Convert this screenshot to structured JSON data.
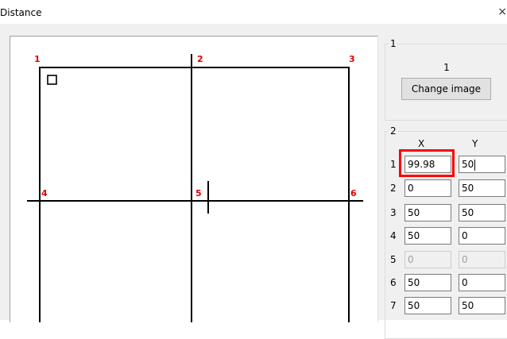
{
  "window": {
    "title": "Distance",
    "close_icon": "×"
  },
  "canvas": {
    "points": [
      {
        "label": "1"
      },
      {
        "label": "2"
      },
      {
        "label": "3"
      },
      {
        "label": "4"
      },
      {
        "label": "5"
      },
      {
        "label": "6"
      }
    ]
  },
  "group1": {
    "legend": "1",
    "image_index": "1",
    "change_image_label": "Change image"
  },
  "group2": {
    "legend": "2",
    "col_x": "X",
    "col_y": "Y",
    "rows": [
      {
        "num": "1",
        "x": "99.98",
        "y": "50"
      },
      {
        "num": "2",
        "x": "0",
        "y": "50"
      },
      {
        "num": "3",
        "x": "50",
        "y": "50"
      },
      {
        "num": "4",
        "x": "50",
        "y": "0"
      },
      {
        "num": "5",
        "x": "0",
        "y": "0",
        "disabled": true
      },
      {
        "num": "6",
        "x": "50",
        "y": "0"
      },
      {
        "num": "7",
        "x": "50",
        "y": "50"
      }
    ]
  },
  "colors": {
    "point_label": "#e00000",
    "highlight": "#ff0000"
  }
}
